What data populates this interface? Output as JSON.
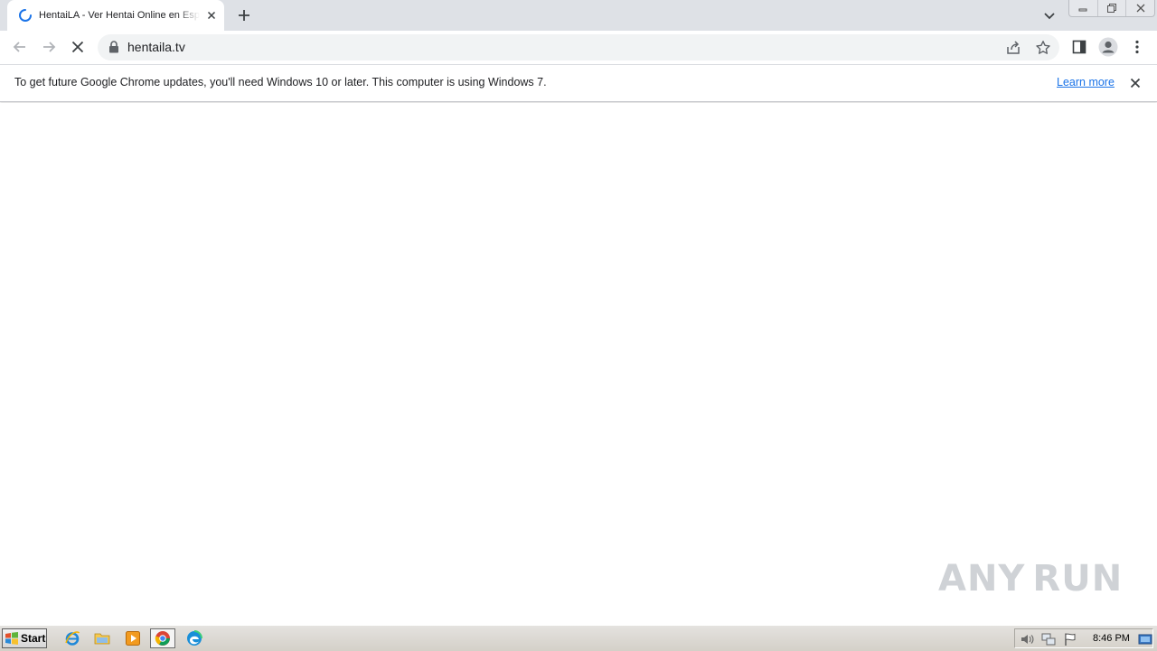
{
  "browser": {
    "tab": {
      "title": "HentaiLA - Ver Hentai Online en Español"
    },
    "address_bar": {
      "url": "hentaila.tv"
    }
  },
  "infobar": {
    "message": "To get future Google Chrome updates, you'll need Windows 10 or later. This computer is using Windows 7.",
    "link_label": "Learn more"
  },
  "watermark": {
    "left": "ANY",
    "right": "RUN"
  },
  "taskbar": {
    "start_label": "Start",
    "clock": "8:46 PM",
    "apps": [
      "internet-explorer-icon",
      "file-explorer-icon",
      "media-player-icon",
      "chrome-icon",
      "edge-icon"
    ]
  },
  "colors": {
    "tab_strip": "#dee1e6",
    "link": "#1a73e8",
    "spinner": "#1a73e8"
  }
}
